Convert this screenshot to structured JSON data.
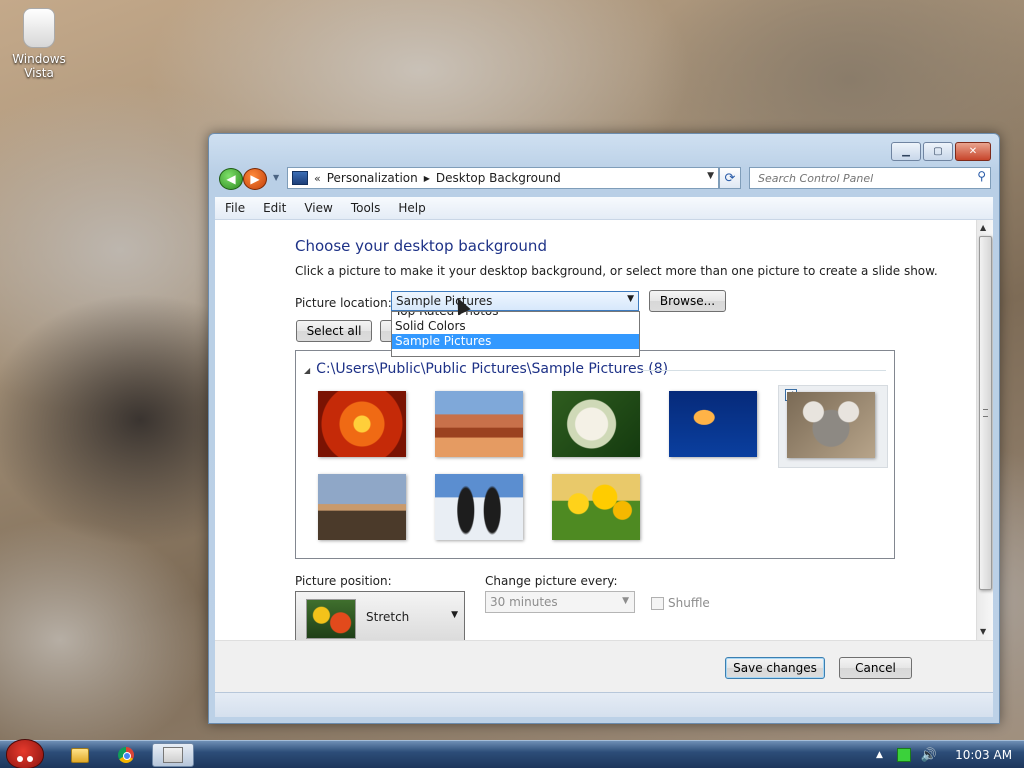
{
  "desktop": {
    "icon_label_line1": "Windows",
    "icon_label_line2": "Vista"
  },
  "window": {
    "address": {
      "chevron": "«",
      "crumbs": [
        "Personalization",
        "Desktop Background"
      ]
    },
    "search_placeholder": "Search Control Panel",
    "menu": [
      "File",
      "Edit",
      "View",
      "Tools",
      "Help"
    ],
    "title": "Choose your desktop background",
    "subtitle": "Click a picture to make it your desktop background, or select more than one picture to create a slide show.",
    "picture_location": {
      "label": "Picture location:",
      "value": "Sample Pictures",
      "options": [
        "Top Rated Photos",
        "Solid Colors",
        "Sample Pictures"
      ],
      "selected_index": 2
    },
    "browse_label": "Browse...",
    "select_all_label": "Select all",
    "gallery": {
      "heading": "C:\\Users\\Public\\Public Pictures\\Sample Pictures (8)",
      "pictures": [
        {
          "name": "chrysanthemum",
          "selected": false
        },
        {
          "name": "desert",
          "selected": false
        },
        {
          "name": "hydrangeas",
          "selected": false
        },
        {
          "name": "jellyfish",
          "selected": false
        },
        {
          "name": "koala",
          "selected": true
        },
        {
          "name": "lighthouse",
          "selected": false
        },
        {
          "name": "penguins",
          "selected": false
        },
        {
          "name": "tulips",
          "selected": false
        }
      ]
    },
    "picture_position": {
      "label": "Picture position:",
      "value": "Stretch"
    },
    "change_picture": {
      "label": "Change picture every:",
      "value": "30 minutes",
      "enabled": false
    },
    "shuffle_label": "Shuffle",
    "save_label": "Save changes",
    "cancel_label": "Cancel"
  },
  "taskbar": {
    "clock": "10:03 AM",
    "apps": [
      "angry-birds-start",
      "windows-explorer",
      "google-chrome",
      "control-panel"
    ]
  },
  "colors": {
    "heading_blue": "#1e3287",
    "selection_blue": "#3399ff"
  }
}
